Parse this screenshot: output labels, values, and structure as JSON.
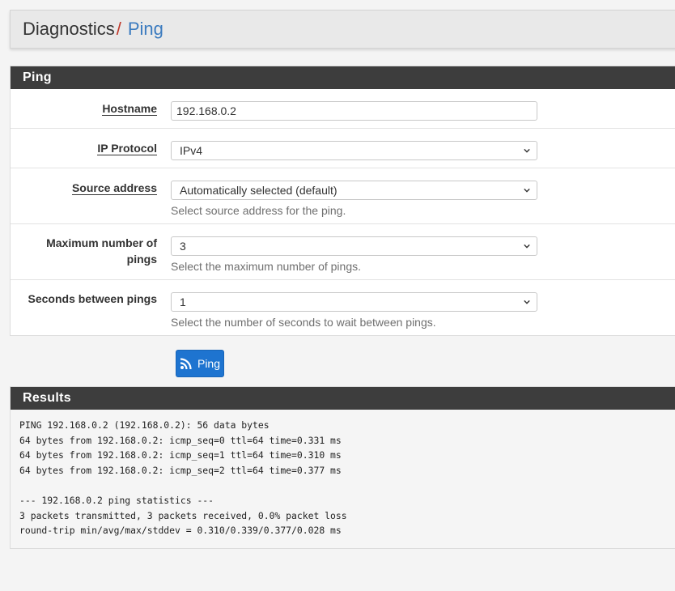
{
  "breadcrumb": {
    "parent": "Diagnostics",
    "separator": "/",
    "current": "Ping"
  },
  "ping_panel": {
    "title": "Ping",
    "hostname": {
      "label": "Hostname",
      "value": "192.168.0.2"
    },
    "ip_protocol": {
      "label": "IP Protocol",
      "selected": "IPv4"
    },
    "source_address": {
      "label": "Source address",
      "selected": "Automatically selected (default)",
      "help": "Select source address for the ping."
    },
    "max_pings": {
      "label_line1": "Maximum number of",
      "label_line2": "pings",
      "selected": "3",
      "help": "Select the maximum number of pings."
    },
    "seconds_between": {
      "label": "Seconds between pings",
      "selected": "1",
      "help": "Select the number of seconds to wait between pings."
    }
  },
  "ping_button": {
    "label": "Ping",
    "icon": "rss-icon"
  },
  "results_panel": {
    "title": "Results",
    "lines": [
      "PING 192.168.0.2 (192.168.0.2): 56 data bytes",
      "64 bytes from 192.168.0.2: icmp_seq=0 ttl=64 time=0.331 ms",
      "64 bytes from 192.168.0.2: icmp_seq=1 ttl=64 time=0.310 ms",
      "64 bytes from 192.168.0.2: icmp_seq=2 ttl=64 time=0.377 ms",
      "",
      "--- 192.168.0.2 ping statistics ---",
      "3 packets transmitted, 3 packets received, 0.0% packet loss",
      "round-trip min/avg/max/stddev = 0.310/0.339/0.377/0.028 ms"
    ]
  },
  "colors": {
    "breadcrumb_separator": "#c0392b",
    "breadcrumb_current": "#3b7bbf",
    "panel_heading": "#3d3d3d",
    "button_primary": "#1e74d0"
  }
}
